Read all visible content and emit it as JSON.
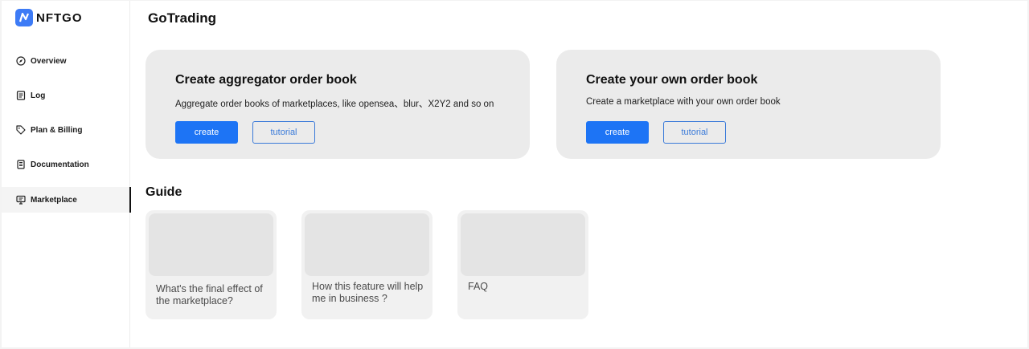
{
  "brand": {
    "name": "NFTGO",
    "color": "#3d7bf6"
  },
  "sidebar": {
    "items": [
      {
        "label": "Overview",
        "icon": "compass-icon"
      },
      {
        "label": "Log",
        "icon": "document-list-icon"
      },
      {
        "label": "Plan & Billing",
        "icon": "tag-icon"
      },
      {
        "label": "Documentation",
        "icon": "book-icon"
      },
      {
        "label": "Marketplace",
        "icon": "monitor-icon",
        "active": true
      }
    ]
  },
  "header": {
    "title": "GoTrading"
  },
  "cards": [
    {
      "title": "Create aggregator order book",
      "description": "Aggregate order books of marketplaces, like opensea、blur、X2Y2 and so on",
      "primary_label": "create",
      "secondary_label": "tutorial"
    },
    {
      "title": "Create your own order book",
      "description": "Create a marketplace with your own order book",
      "primary_label": "create",
      "secondary_label": "tutorial"
    }
  ],
  "guide": {
    "title": "Guide",
    "items": [
      {
        "text": "What's the final effect of the marketplace?"
      },
      {
        "text": "How this feature will help me in business ?"
      },
      {
        "text": "FAQ"
      }
    ]
  },
  "colors": {
    "accent": "#1d74f5",
    "card_bg": "#ebebeb",
    "guide_bg": "#f1f1f1"
  }
}
